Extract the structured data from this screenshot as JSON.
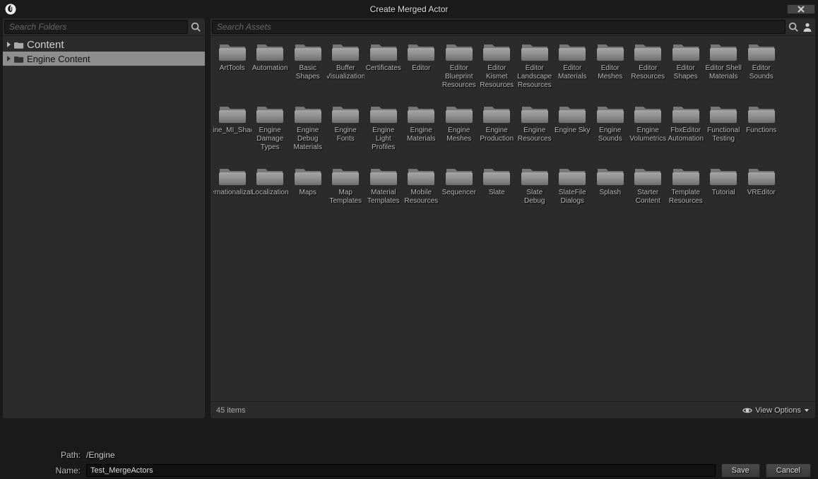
{
  "window": {
    "title": "Create Merged Actor"
  },
  "left": {
    "search_placeholder": "Search Folders",
    "tree": [
      {
        "label": "Content",
        "selected": false
      },
      {
        "label": "Engine Content",
        "selected": true
      }
    ]
  },
  "right": {
    "search_placeholder": "Search Assets",
    "folders": [
      "ArtTools",
      "Automation",
      "Basic Shapes",
      "Buffer Visualization",
      "Certificates",
      "Editor",
      "Editor Blueprint Resources",
      "Editor Kismet Resources",
      "Editor Landscape Resources",
      "Editor Materials",
      "Editor Meshes",
      "Editor Resources",
      "Editor Shapes",
      "Editor Shell Materials",
      "Editor Sounds",
      "Engine_MI_Shaders",
      "Engine Damage Types",
      "Engine Debug Materials",
      "Engine Fonts",
      "Engine Light Profiles",
      "Engine Materials",
      "Engine Meshes",
      "Engine Production",
      "Engine Resources",
      "Engine Sky",
      "Engine Sounds",
      "Engine Volumetrics",
      "FbxEditor Automation",
      "Functional Testing",
      "Functions",
      "Internationalization",
      "Localization",
      "Maps",
      "Map Templates",
      "Material Templates",
      "Mobile Resources",
      "Sequencer",
      "Slate",
      "Slate Debug",
      "SlateFile Dialogs",
      "Splash",
      "Starter Content",
      "Template Resources",
      "Tutorial",
      "VREditor"
    ],
    "item_count_text": "45 items",
    "view_options_label": "View Options"
  },
  "bottom": {
    "path_label": "Path:",
    "path_value": "/Engine",
    "name_label": "Name:",
    "name_value": "Test_MergeActors",
    "save_label": "Save",
    "cancel_label": "Cancel"
  }
}
